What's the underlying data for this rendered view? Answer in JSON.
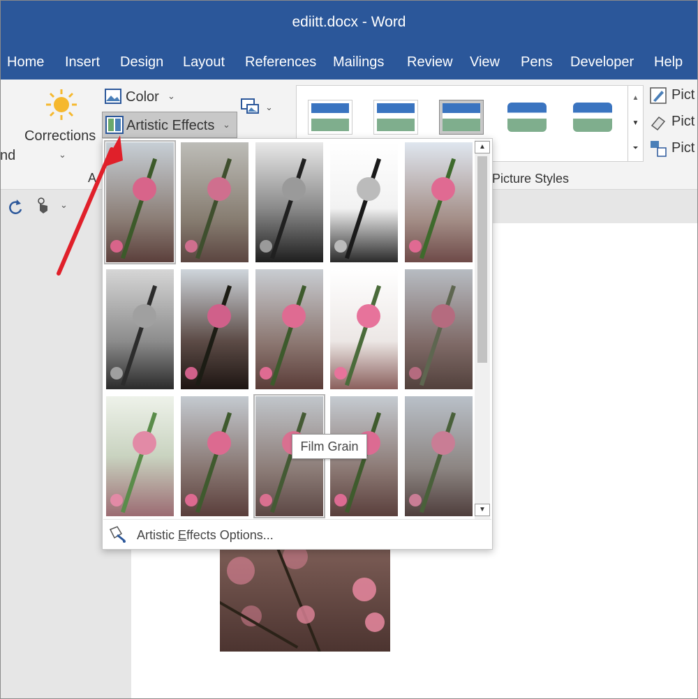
{
  "window": {
    "title": "ediitt.docx  -  Word"
  },
  "tabs": [
    {
      "label": "Home"
    },
    {
      "label": "Insert"
    },
    {
      "label": "Design"
    },
    {
      "label": "Layout"
    },
    {
      "label": "References"
    },
    {
      "label": "Mailings"
    },
    {
      "label": "Review"
    },
    {
      "label": "View"
    },
    {
      "label": "Pens"
    },
    {
      "label": "Developer"
    },
    {
      "label": "Help"
    }
  ],
  "ribbon": {
    "left_partial_label": "nd",
    "corrections_label": "Corrections",
    "color_label": "Color",
    "artistic_effects_label": "Artistic Effects",
    "group_partial_label": "A",
    "picture_styles_label": "Picture Styles",
    "pict_labels": [
      "Pict",
      "Pict",
      "Pict"
    ]
  },
  "gallery": {
    "tooltip": "Film Grain",
    "options_label": "Artistic Effects Options...",
    "options_access_key": "E"
  },
  "colors": {
    "title_bar": "#2b579a",
    "ribbon_bg": "#f3f3f3",
    "accent_arrow": "#e0202a"
  }
}
